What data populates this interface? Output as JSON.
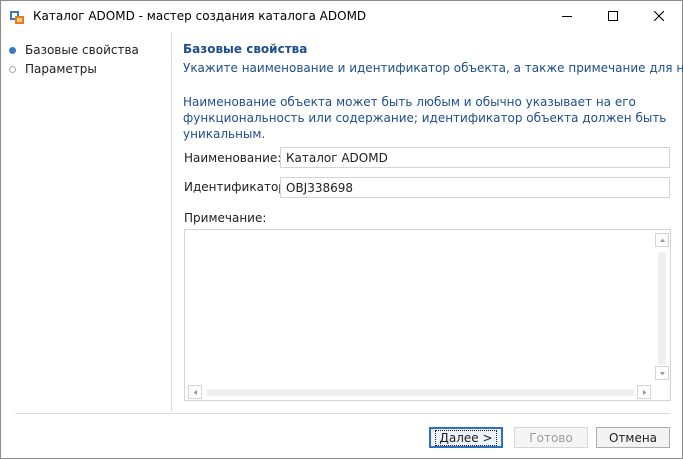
{
  "window": {
    "title": "Каталог ADOMD - мастер создания каталога ADOMD"
  },
  "nav": {
    "items": [
      {
        "label": "Базовые свойства",
        "active": true
      },
      {
        "label": "Параметры",
        "active": false
      }
    ]
  },
  "content": {
    "heading": "Базовые свойства",
    "subheading": "Укажите наименование и идентификатор объекта, а также примечание для него.",
    "description": "Наименование объекта может быть любым и обычно указывает на его функциональность или содержание; идентификатор объекта должен быть уникальным.",
    "fields": {
      "name_label": "Наименование:",
      "name_value": "Каталог ADOMD",
      "id_label": "Идентификатор:",
      "id_value": "OBJ338698",
      "note_label": "Примечание:",
      "note_value": ""
    }
  },
  "buttons": {
    "next": "Далее >",
    "finish": "Готово",
    "cancel": "Отмена"
  },
  "colors": {
    "accent": "#3a78c8",
    "heading_text": "#1e4e8c"
  },
  "icons": {
    "app": "catalog-app-icon",
    "minimize": "minimize-icon",
    "maximize": "maximize-icon",
    "close": "close-icon"
  }
}
